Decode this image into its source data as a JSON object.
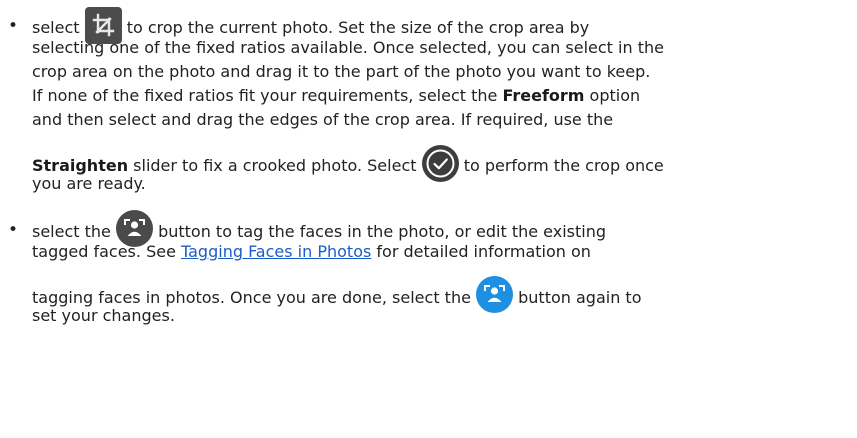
{
  "items": [
    {
      "lines": [
        {
          "before": "select ",
          "after": " to crop the current photo. Set the size of the crop area by"
        },
        {
          "text": "selecting one of the fixed ratios available. Once selected, you can select in the"
        },
        {
          "text": "crop area on the photo and drag it to the part of the photo you want to keep."
        },
        {
          "before": "If none of the fixed ratios fit your requirements, select the ",
          "bold": "Freeform",
          "after": " option"
        },
        {
          "text": "and then select and drag the edges of the crop area. If required, use the"
        },
        {
          "bold": "Straighten",
          "before": " slider to fix a crooked photo. Select ",
          "after": " to perform the crop once"
        },
        {
          "text": "you are ready."
        }
      ],
      "icons": [
        "crop-icon",
        "checkmark-circle-icon"
      ]
    },
    {
      "lines": [
        {
          "before": "select the ",
          "after": " button to tag the faces in the photo, or edit the existing"
        },
        {
          "before": "tagged faces. See ",
          "link": "Tagging Faces in Photos",
          "after": " for detailed information on"
        },
        {
          "before": "tagging faces in photos. Once you are done, select the ",
          "after": " button again to"
        },
        {
          "text": "set your changes."
        }
      ],
      "icons": [
        "tag-faces-icon",
        "tag-faces-active-icon"
      ]
    }
  ],
  "bullet": "•",
  "colors": {
    "text": "#222222",
    "link": "#1a5cc8",
    "crop_icon_bg": "#4c4c4c",
    "check_icon_bg": "#3d3d3d",
    "face_icon_bg": "#4a4a4a",
    "face_icon_active_bg": "#1e8fe1"
  }
}
